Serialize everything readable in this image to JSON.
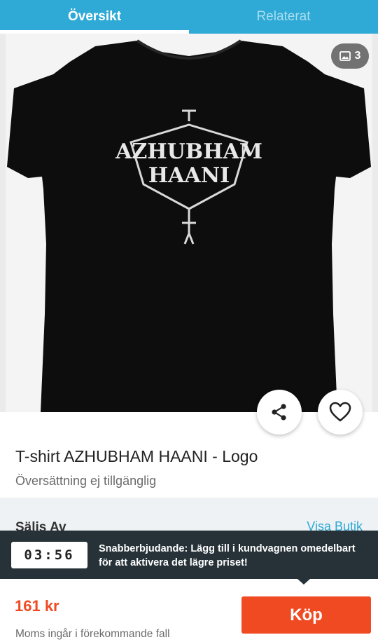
{
  "tabs": [
    {
      "label": "Översikt",
      "active": true
    },
    {
      "label": "Relaterat",
      "active": false
    }
  ],
  "gallery": {
    "photo_count": "3",
    "count_icon": "image-icon",
    "print_text_line1": "AZHUBHAM",
    "print_text_line2": "HAANI"
  },
  "actions": {
    "share_icon": "share-icon",
    "favorite_icon": "heart-outline-icon"
  },
  "product": {
    "title": "T-shirt AZHUBHAM HAANI - Logo",
    "translation_note": "Översättning ej tillgänglig"
  },
  "seller": {
    "label": "Säljs Av",
    "shop_link": "Visa Butik"
  },
  "banner": {
    "timer": "03:56",
    "text": "Snabberbjudande: Lägg till i kundvagnen omedelbart för att aktivera det lägre priset!"
  },
  "purchase": {
    "price": "161 kr",
    "vat_note": "Moms ingår i förekommande fall",
    "buy_label": "Köp"
  },
  "colors": {
    "accent": "#2fa9d5",
    "price": "#f04a23",
    "banner_bg": "#263238"
  }
}
